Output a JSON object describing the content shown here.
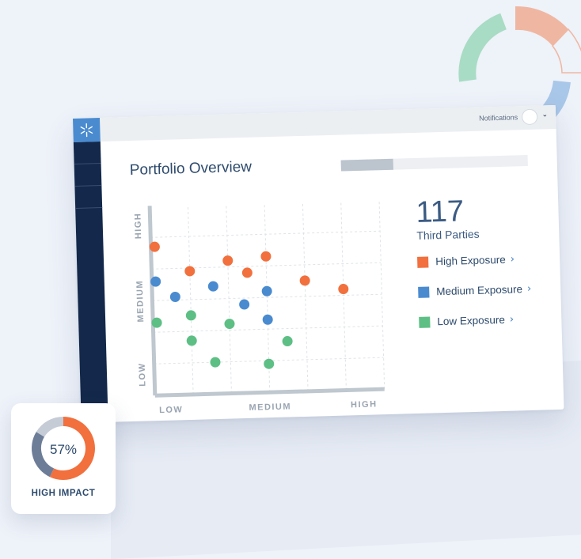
{
  "header": {
    "notifications_label": "Notifications"
  },
  "sidebar": {
    "items": [
      "",
      "",
      ""
    ]
  },
  "overview": {
    "title": "Portfolio Overview",
    "progress": 0.28
  },
  "summary": {
    "count": "117",
    "count_label": "Third Parties",
    "legend": [
      {
        "label": "High Exposure",
        "color": "#f1703e"
      },
      {
        "label": "Medium Exposure",
        "color": "#4a8bd0"
      },
      {
        "label": "Low Exposure",
        "color": "#5dbf84"
      }
    ]
  },
  "impact_card": {
    "percent": "57%",
    "percent_value": 57,
    "label": "HIGH IMPACT",
    "colors": {
      "primary": "#f1703e",
      "secondary": "#6d7d97",
      "tertiary": "#c5ccd6"
    }
  },
  "chart_data": {
    "type": "scatter",
    "x_categories": [
      "LOW",
      "MEDIUM",
      "HIGH"
    ],
    "y_categories": [
      "LOW",
      "MEDIUM",
      "HIGH"
    ],
    "xlim": [
      0,
      6
    ],
    "ylim": [
      0,
      6
    ],
    "grid": true,
    "series": [
      {
        "name": "High Exposure",
        "color": "#f1703e",
        "points": [
          [
            0.1,
            4.7
          ],
          [
            1.0,
            3.9
          ],
          [
            2.0,
            4.2
          ],
          [
            2.5,
            3.8
          ],
          [
            3.0,
            4.3
          ],
          [
            4.0,
            3.5
          ],
          [
            5.0,
            3.2
          ]
        ]
      },
      {
        "name": "Medium Exposure",
        "color": "#4a8bd0",
        "points": [
          [
            0.1,
            3.6
          ],
          [
            0.6,
            3.1
          ],
          [
            1.6,
            3.4
          ],
          [
            2.4,
            2.8
          ],
          [
            3.0,
            3.2
          ],
          [
            3.0,
            2.3
          ]
        ]
      },
      {
        "name": "Low Exposure",
        "color": "#5dbf84",
        "points": [
          [
            0.1,
            2.3
          ],
          [
            1.0,
            2.5
          ],
          [
            2.0,
            2.2
          ],
          [
            1.0,
            1.7
          ],
          [
            3.5,
            1.6
          ],
          [
            1.6,
            1.0
          ],
          [
            3.0,
            0.9
          ]
        ]
      }
    ]
  },
  "decorations": {
    "ring_colors": [
      "#a8dcc4",
      "#efb7a2",
      "#a9c7e8"
    ]
  }
}
